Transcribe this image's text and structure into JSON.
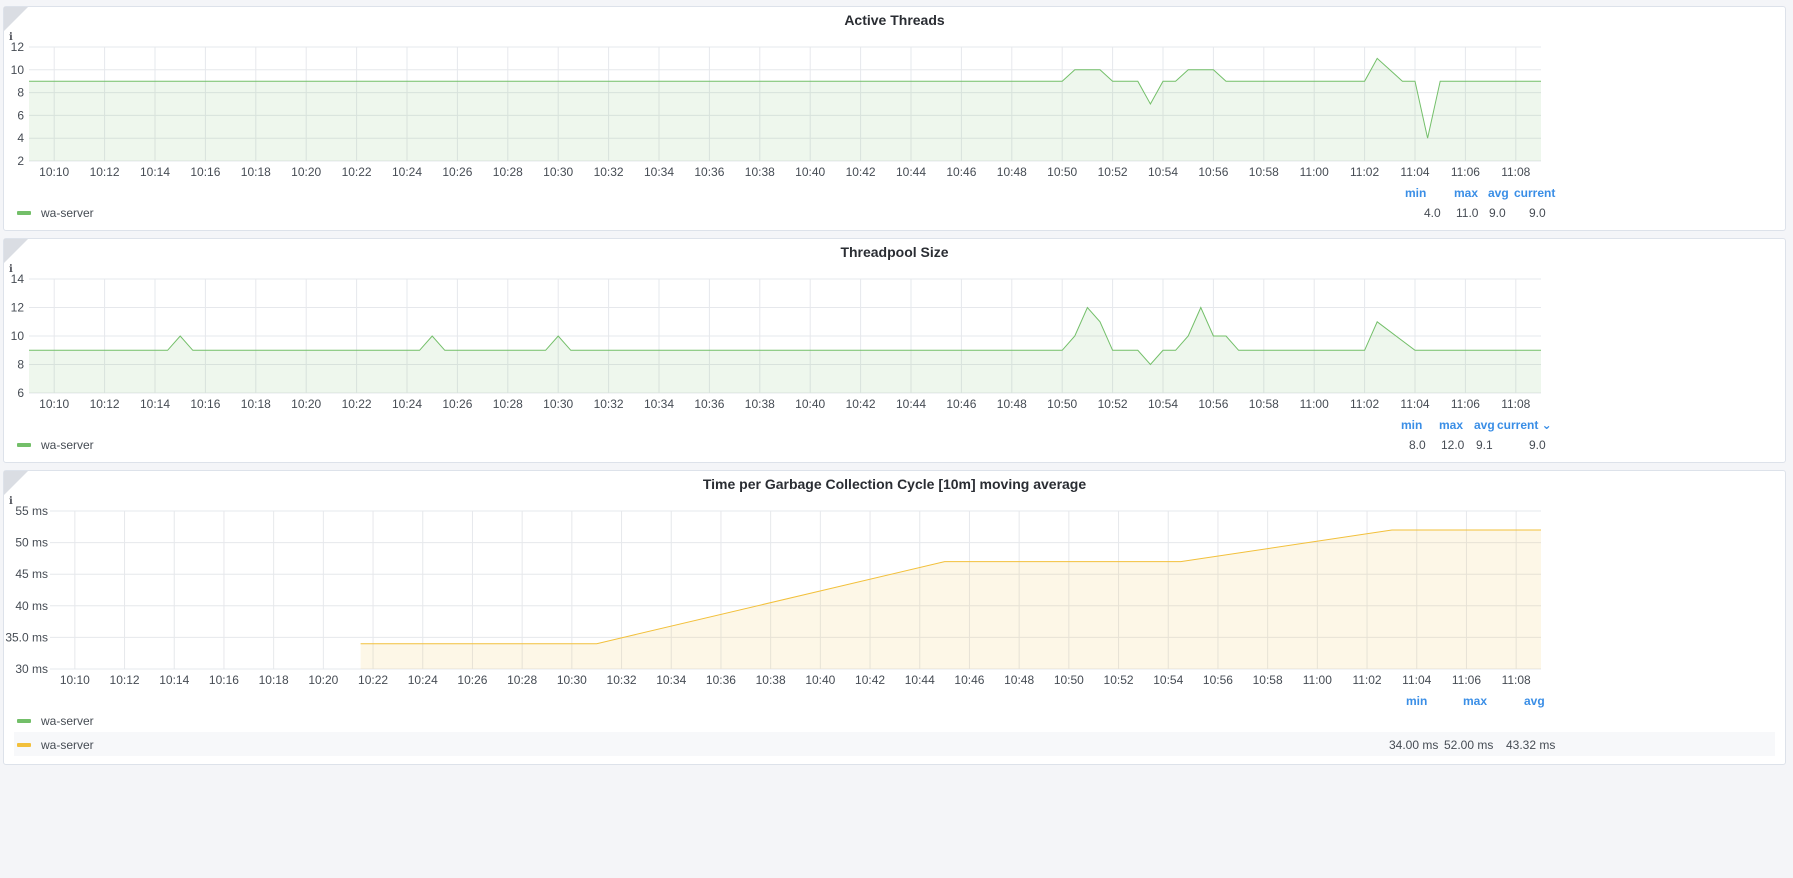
{
  "panels": [
    {
      "id": "active-threads",
      "title": "Active Threads",
      "info_icon": "info-icon",
      "legend": [
        {
          "name": "wa-server",
          "color": "#73bf69"
        }
      ],
      "stats": {
        "headers": [
          "min",
          "max",
          "avg",
          "current"
        ],
        "values": [
          "4.0",
          "11.0",
          "9.0",
          "9.0"
        ]
      }
    },
    {
      "id": "threadpool-size",
      "title": "Threadpool Size",
      "info_icon": "info-icon",
      "legend": [
        {
          "name": "wa-server",
          "color": "#73bf69"
        }
      ],
      "stats": {
        "headers": [
          "min",
          "max",
          "avg",
          "current ⌄"
        ],
        "values": [
          "8.0",
          "12.0",
          "9.1",
          "9.0"
        ]
      }
    },
    {
      "id": "gc-time",
      "title": "Time per Garbage Collection Cycle [10m] moving average",
      "info_icon": "info-icon",
      "legend": [
        {
          "name": "wa-server",
          "color": "#73bf69"
        },
        {
          "name": "wa-server",
          "color": "#f2c03b"
        }
      ],
      "stats": {
        "headers": [
          "min",
          "max",
          "avg"
        ],
        "values": [
          "34.00 ms",
          "52.00 ms",
          "43.32 ms"
        ]
      }
    }
  ],
  "chart_data": [
    {
      "type": "area",
      "title": "Active Threads",
      "y_ticks": [
        "2",
        "4",
        "6",
        "8",
        "10",
        "12"
      ],
      "ylim": [
        2,
        12
      ],
      "xlim": [
        "10:09",
        "11:09"
      ],
      "x_ticks": [
        "10:10",
        "10:12",
        "10:14",
        "10:16",
        "10:18",
        "10:20",
        "10:22",
        "10:24",
        "10:26",
        "10:28",
        "10:30",
        "10:32",
        "10:34",
        "10:36",
        "10:38",
        "10:40",
        "10:42",
        "10:44",
        "10:46",
        "10:48",
        "10:50",
        "10:52",
        "10:54",
        "10:56",
        "10:58",
        "11:00",
        "11:02",
        "11:04",
        "11:06",
        "11:08"
      ],
      "grid": true,
      "legend_position": "bottom-left",
      "series": [
        {
          "name": "wa-server",
          "color": "#73bf69",
          "points": [
            [
              "10:09",
              9
            ],
            [
              "10:50",
              9
            ],
            [
              "10:50:30",
              10
            ],
            [
              "10:51:30",
              10
            ],
            [
              "10:52",
              9
            ],
            [
              "10:53",
              9
            ],
            [
              "10:53:30",
              7
            ],
            [
              "10:54",
              9
            ],
            [
              "10:54:30",
              9
            ],
            [
              "10:55",
              10
            ],
            [
              "10:56",
              10
            ],
            [
              "10:56:30",
              9
            ],
            [
              "11:02",
              9
            ],
            [
              "11:02:30",
              11
            ],
            [
              "11:03:30",
              9
            ],
            [
              "11:04",
              9
            ],
            [
              "11:04:30",
              4
            ],
            [
              "11:05",
              9
            ],
            [
              "11:09",
              9
            ]
          ]
        }
      ]
    },
    {
      "type": "area",
      "title": "Threadpool Size",
      "y_ticks": [
        "6",
        "8",
        "10",
        "12",
        "14"
      ],
      "ylim": [
        6,
        14
      ],
      "xlim": [
        "10:09",
        "11:09"
      ],
      "x_ticks": [
        "10:10",
        "10:12",
        "10:14",
        "10:16",
        "10:18",
        "10:20",
        "10:22",
        "10:24",
        "10:26",
        "10:28",
        "10:30",
        "10:32",
        "10:34",
        "10:36",
        "10:38",
        "10:40",
        "10:42",
        "10:44",
        "10:46",
        "10:48",
        "10:50",
        "10:52",
        "10:54",
        "10:56",
        "10:58",
        "11:00",
        "11:02",
        "11:04",
        "11:06",
        "11:08"
      ],
      "grid": true,
      "legend_position": "bottom-left",
      "series": [
        {
          "name": "wa-server",
          "color": "#73bf69",
          "points": [
            [
              "10:09",
              9
            ],
            [
              "10:14:30",
              9
            ],
            [
              "10:15",
              10
            ],
            [
              "10:15:30",
              9
            ],
            [
              "10:24:30",
              9
            ],
            [
              "10:25",
              10
            ],
            [
              "10:25:30",
              9
            ],
            [
              "10:29:30",
              9
            ],
            [
              "10:30",
              10
            ],
            [
              "10:30:30",
              9
            ],
            [
              "10:50",
              9
            ],
            [
              "10:50:30",
              10
            ],
            [
              "10:51",
              12
            ],
            [
              "10:51:30",
              11
            ],
            [
              "10:52",
              9
            ],
            [
              "10:53",
              9
            ],
            [
              "10:53:30",
              8
            ],
            [
              "10:54",
              9
            ],
            [
              "10:54:30",
              9
            ],
            [
              "10:55",
              10
            ],
            [
              "10:55:30",
              12
            ],
            [
              "10:56",
              10
            ],
            [
              "10:56:30",
              10
            ],
            [
              "10:57",
              9
            ],
            [
              "11:02",
              9
            ],
            [
              "11:02:30",
              11
            ],
            [
              "11:04",
              9
            ],
            [
              "11:09",
              9
            ]
          ]
        }
      ]
    },
    {
      "type": "area",
      "title": "Time per Garbage Collection Cycle [10m] moving average",
      "y_ticks": [
        "30 ms",
        "35.0 ms",
        "40 ms",
        "45 ms",
        "50 ms",
        "55 ms"
      ],
      "ylim": [
        30,
        55
      ],
      "xlim": [
        "10:09",
        "11:09"
      ],
      "x_ticks": [
        "10:10",
        "10:12",
        "10:14",
        "10:16",
        "10:18",
        "10:20",
        "10:22",
        "10:24",
        "10:26",
        "10:28",
        "10:30",
        "10:32",
        "10:34",
        "10:36",
        "10:38",
        "10:40",
        "10:42",
        "10:44",
        "10:46",
        "10:48",
        "10:50",
        "10:52",
        "10:54",
        "10:56",
        "10:58",
        "11:00",
        "11:02",
        "11:04",
        "11:06",
        "11:08"
      ],
      "grid": true,
      "legend_position": "bottom-left",
      "series": [
        {
          "name": "wa-server",
          "color": "#f2c03b",
          "points": [
            [
              "10:21:30",
              34
            ],
            [
              "10:31",
              34
            ],
            [
              "10:45",
              47
            ],
            [
              "10:54:30",
              47
            ],
            [
              "11:03",
              52
            ],
            [
              "11:09",
              52
            ]
          ]
        }
      ]
    }
  ]
}
